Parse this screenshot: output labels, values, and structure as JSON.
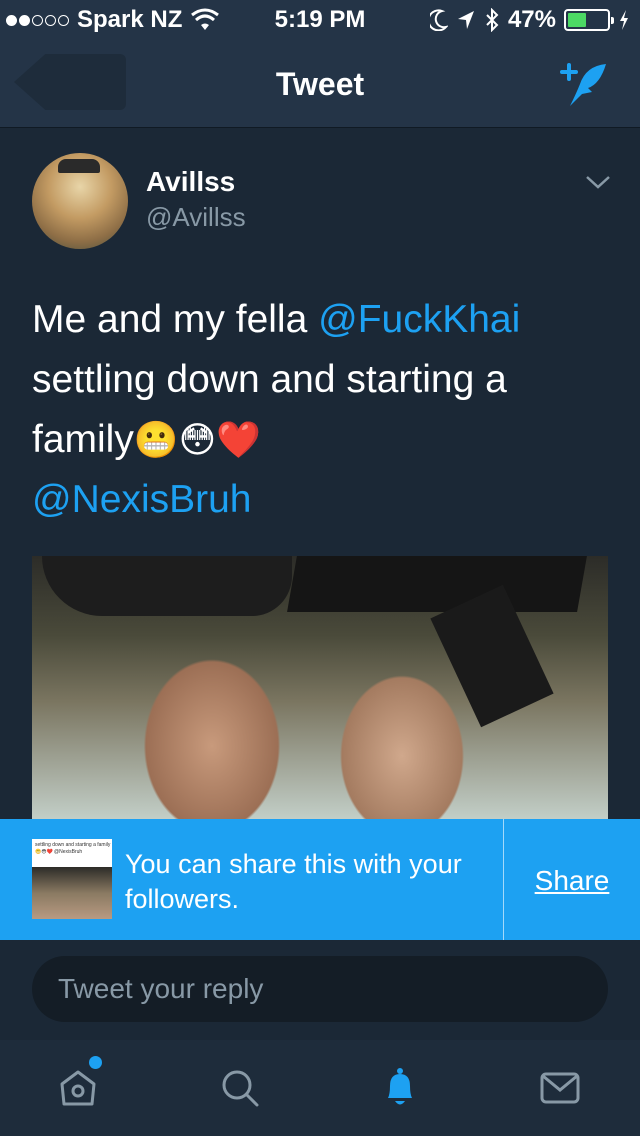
{
  "status_bar": {
    "carrier": "Spark NZ",
    "time": "5:19 PM",
    "battery": "47%",
    "battery_level": 0.47,
    "icons": [
      "signal-dots-icon",
      "wifi-icon",
      "moon-icon",
      "location-arrow-icon",
      "bluetooth-icon",
      "battery-icon",
      "charging-bolt-icon"
    ]
  },
  "nav": {
    "title": "Tweet",
    "compose_icon": "compose-tweet-icon",
    "back_icon": "back-icon"
  },
  "tweet": {
    "display_name": "Avillss",
    "handle": "@Avillss",
    "text_before": "Me and my fella ",
    "mention_1": "@FuckKhai",
    "text_after": " settling down and starting a family",
    "emojis": "😬😳❤️",
    "mention_2": "@NexisBruh",
    "menu_icon": "chevron-down-icon"
  },
  "share_banner": {
    "message": "You can share this with your followers.",
    "action": "Share",
    "thumb_caption": "settling down and starting a family😬😳❤️ @NexisBruh"
  },
  "reply": {
    "placeholder": "Tweet your reply"
  },
  "tab_bar": {
    "tabs": [
      "home-icon",
      "search-icon",
      "notifications-bell-icon",
      "messages-envelope-icon"
    ],
    "active_tab": "notifications",
    "accent": "#1da1f2"
  },
  "colors": {
    "background": "#1b2836",
    "bar": "#243447",
    "accent": "#1da1f2",
    "muted": "#8899a6"
  }
}
